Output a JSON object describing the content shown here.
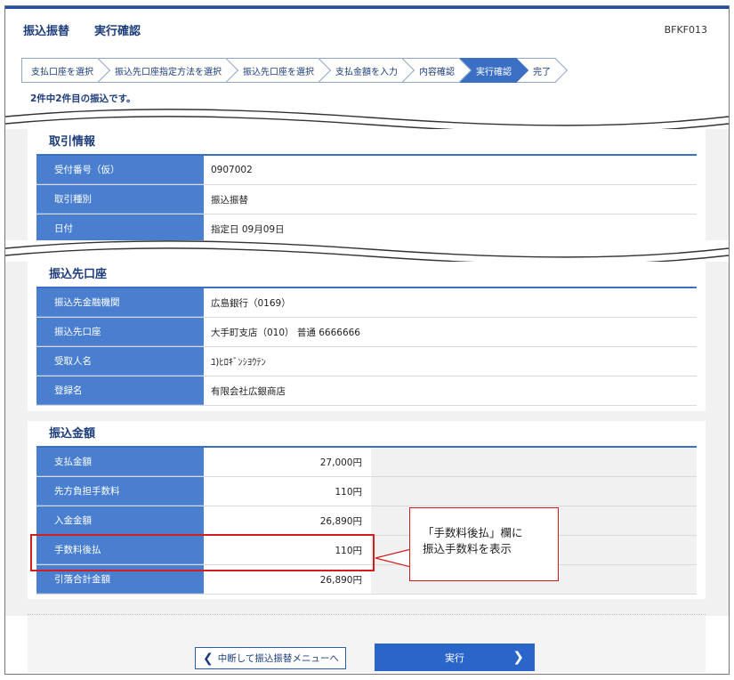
{
  "header": {
    "title": "振込振替",
    "subtitle": "実行確認",
    "screen_code": "BFKF013"
  },
  "steps": [
    {
      "label": "支払口座を選択",
      "active": false
    },
    {
      "label": "振込先口座指定方法を選択",
      "active": false
    },
    {
      "label": "振込先口座を選択",
      "active": false
    },
    {
      "label": "支払金額を入力",
      "active": false
    },
    {
      "label": "内容確認",
      "active": false
    },
    {
      "label": "実行確認",
      "active": true
    },
    {
      "label": "完了",
      "active": false
    }
  ],
  "notice": "2件中2件目の振込です。",
  "transaction": {
    "title": "取引情報",
    "rows": [
      {
        "label": "受付番号（仮）",
        "value": "0907002"
      },
      {
        "label": "取引種別",
        "value": "振込振替"
      },
      {
        "label": "日付",
        "value": "指定日 09月09日"
      }
    ]
  },
  "payee": {
    "title": "振込先口座",
    "rows": [
      {
        "label": "振込先金融機関",
        "value": "広島銀行（0169）"
      },
      {
        "label": "振込先口座",
        "value": "大手町支店（010） 普通 6666666"
      },
      {
        "label": "受取人名",
        "value": "ﾕ)ﾋﾛｷﾞﾝｼﾖｳﾃﾝ"
      },
      {
        "label": "登録名",
        "value": "有限会社広銀商店"
      }
    ]
  },
  "amount": {
    "title": "振込金額",
    "rows": [
      {
        "label": "支払金額",
        "value": "27,000円"
      },
      {
        "label": "先方負担手数料",
        "value": "110円"
      },
      {
        "label": "入金金額",
        "value": "26,890円"
      },
      {
        "label": "手数料後払",
        "value": "110円"
      },
      {
        "label": "引落合計金額",
        "value": "26,890円"
      }
    ]
  },
  "callout": {
    "line1": "「手数料後払」欄に",
    "line2": "振込手数料を表示"
  },
  "buttons": {
    "back": "中断して振込振替メニューへ",
    "execute": "実行"
  },
  "colors": {
    "primary": "#2a66c9",
    "label_bg": "#4a7fd0",
    "title": "#1d3d7a",
    "highlight": "#d21e1e"
  }
}
